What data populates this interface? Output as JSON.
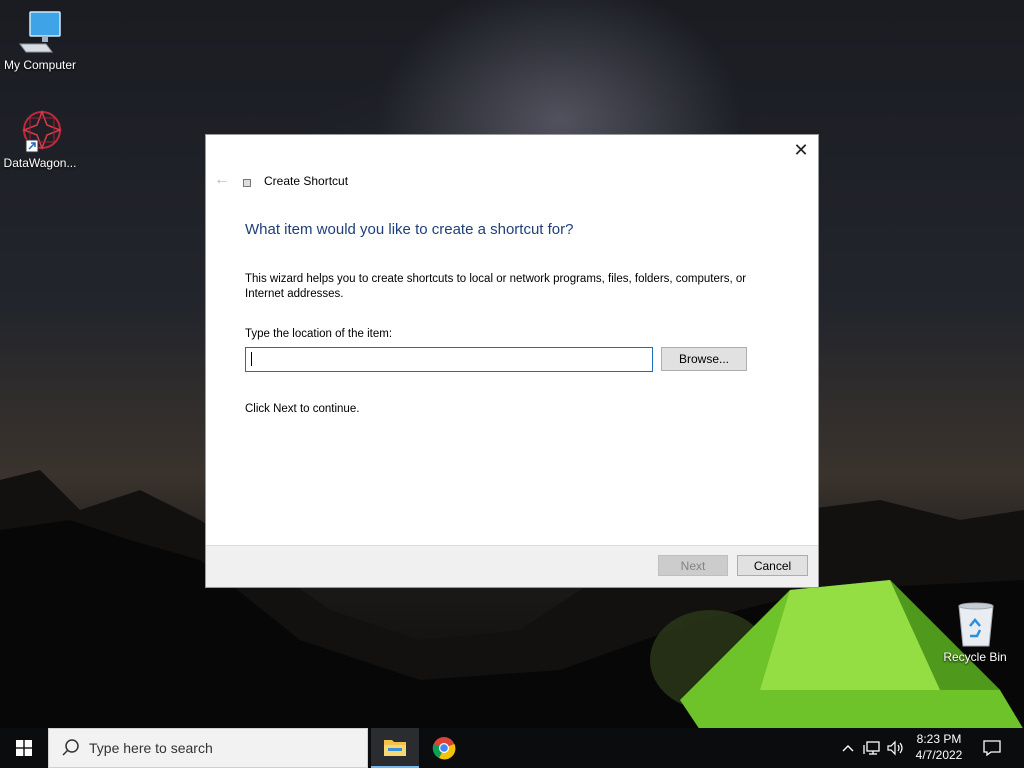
{
  "desktop": {
    "icons": [
      {
        "label": "My Computer"
      },
      {
        "label": "DataWagon..."
      },
      {
        "label": "Recycle Bin"
      }
    ]
  },
  "dialog": {
    "title": "Create Shortcut",
    "close_glyph": "✕",
    "back_glyph": "←",
    "heading": "What item would you like to create a shortcut for?",
    "description": "This wizard helps you to create shortcuts to local or network programs, files, folders, computers, or Internet addresses.",
    "field_label": "Type the location of the item:",
    "location_value": "",
    "browse_label": "Browse...",
    "continue_text": "Click Next to continue.",
    "next_label": "Next",
    "cancel_label": "Cancel"
  },
  "taskbar": {
    "search_placeholder": "Type here to search",
    "time": "8:23 PM",
    "date": "4/7/2022",
    "accent": "#76b9ed"
  }
}
